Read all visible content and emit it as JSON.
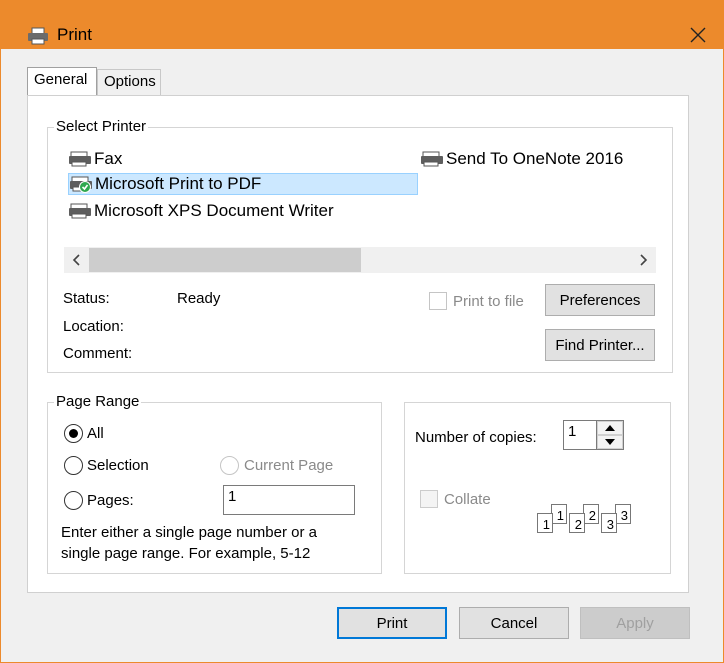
{
  "window": {
    "title": "Print",
    "close_glyph": "✕",
    "title_bar_color": "#ec8a2c"
  },
  "tabs": [
    {
      "label": "General",
      "active": true
    },
    {
      "label": "Options",
      "active": false
    }
  ],
  "select_printer": {
    "label": "Select Printer",
    "printers": [
      {
        "name": "Fax",
        "icon": "fax-icon",
        "selected": false
      },
      {
        "name": "Microsoft Print to PDF",
        "icon": "printer-default-icon",
        "selected": true
      },
      {
        "name": "Microsoft XPS Document Writer",
        "icon": "printer-icon",
        "selected": false
      },
      {
        "name": "Send To OneNote 2016",
        "icon": "printer-icon",
        "selected": false
      }
    ],
    "status_label": "Status:",
    "status_value": "Ready",
    "location_label": "Location:",
    "location_value": "",
    "comment_label": "Comment:",
    "comment_value": "",
    "print_to_file_label": "Print to file",
    "print_to_file_checked": false,
    "preferences_label": "Preferences",
    "find_printer_label": "Find Printer..."
  },
  "page_range": {
    "label": "Page Range",
    "all_label": "All",
    "selection_label": "Selection",
    "current_page_label": "Current Page",
    "pages_label": "Pages:",
    "pages_value": "1",
    "selected_option": "All",
    "hint_line1": "Enter either a single page number or a",
    "hint_line2": "single page range.  For example, 5-12"
  },
  "copies": {
    "number_label": "Number of copies:",
    "number_value": "1",
    "collate_label": "Collate",
    "collate_checked": false,
    "collate_pages": [
      "1",
      "1",
      "2",
      "2",
      "3",
      "3"
    ]
  },
  "footer": {
    "print_label": "Print",
    "cancel_label": "Cancel",
    "apply_label": "Apply"
  }
}
